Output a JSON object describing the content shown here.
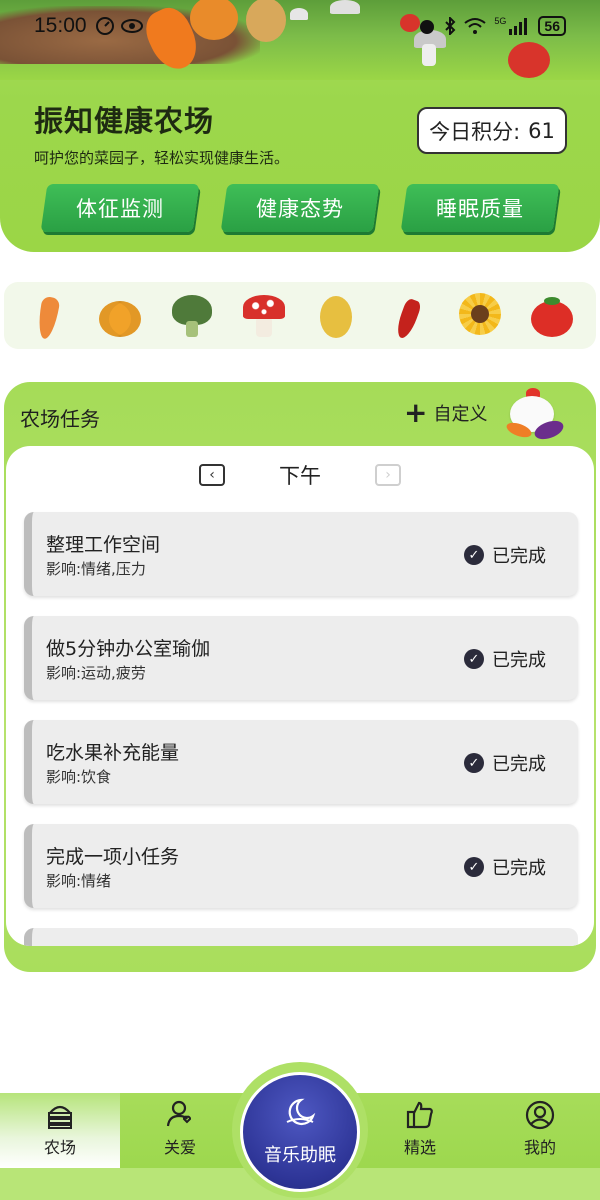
{
  "status_bar": {
    "time": "15:00",
    "battery": "56",
    "network": "5G"
  },
  "header": {
    "title": "振知健康农场",
    "subtitle": "呵护您的菜园子，轻松实现健康生活。",
    "score_label": "今日积分:",
    "score_value": "61",
    "buttons": [
      "体征监测",
      "健康态势",
      "睡眠质量"
    ]
  },
  "veg_strip": {
    "items": [
      "carrot-icon",
      "pumpkin-icon",
      "broccoli-icon",
      "mushroom-icon",
      "potato-icon",
      "chili-pepper-icon",
      "sunflower-icon",
      "tomato-icon"
    ]
  },
  "tasks": {
    "title": "农场任务",
    "custom_label": "自定义",
    "period": "下午",
    "items": [
      {
        "title": "整理工作空间",
        "impact": "影响:情绪,压力",
        "status": "已完成"
      },
      {
        "title": "做5分钟办公室瑜伽",
        "impact": "影响:运动,疲劳",
        "status": "已完成"
      },
      {
        "title": "吃水果补充能量",
        "impact": "影响:饮食",
        "status": "已完成"
      },
      {
        "title": "完成一项小任务",
        "impact": "影响:情绪",
        "status": "已完成"
      }
    ]
  },
  "bottom_nav": {
    "items": [
      {
        "label": "农场",
        "icon": "farm-icon",
        "active": true
      },
      {
        "label": "关爱",
        "icon": "care-icon",
        "active": false
      },
      {
        "label": "精选",
        "icon": "thumbs-up-icon",
        "active": false
      },
      {
        "label": "我的",
        "icon": "profile-icon",
        "active": false
      }
    ],
    "center": {
      "label": "音乐助眠",
      "icon": "moon-icon"
    }
  },
  "colors": {
    "accent_green": "#9bd646",
    "button_green": "#2aa044",
    "center_blue": "#2e3597"
  }
}
